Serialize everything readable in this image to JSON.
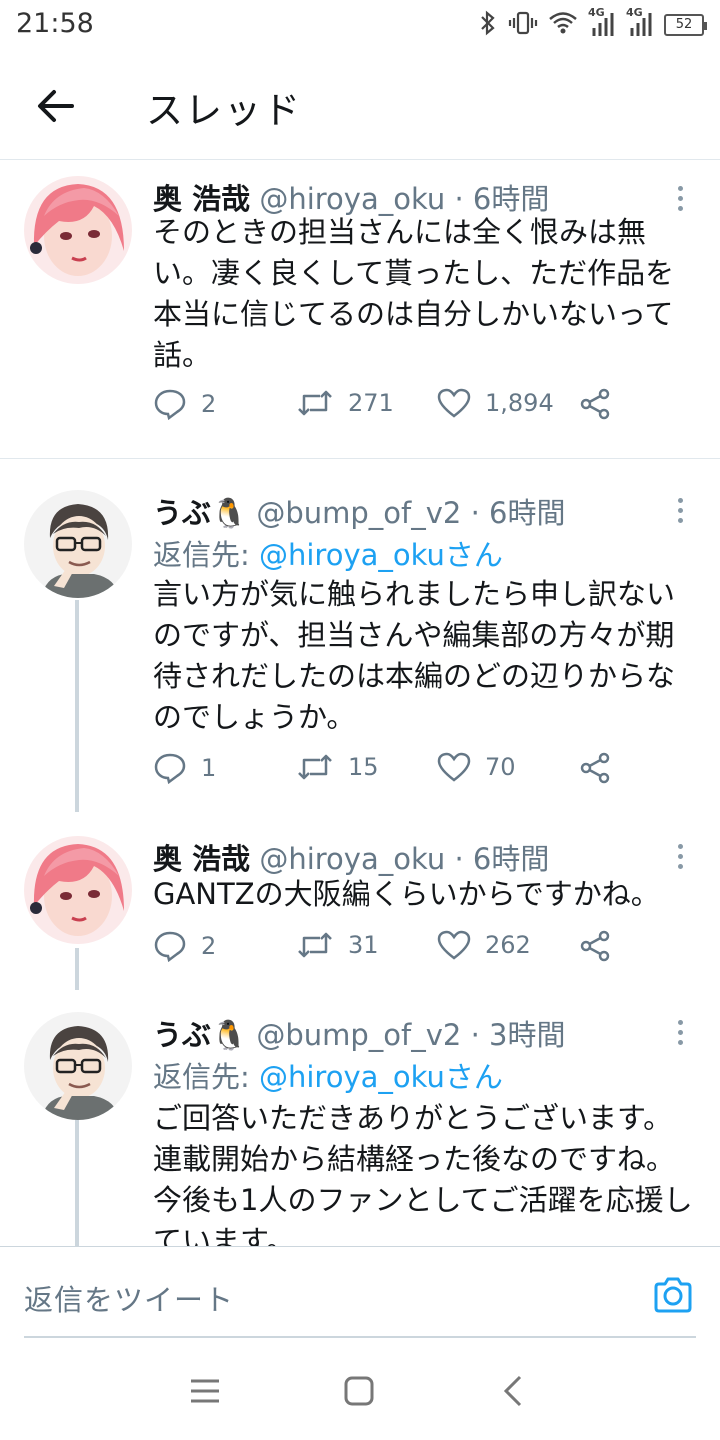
{
  "status_bar": {
    "time": "21:58",
    "network": "4G",
    "network2": "4G",
    "battery": "52"
  },
  "header": {
    "title": "スレッド"
  },
  "tweets": [
    {
      "name": "奥 浩哉",
      "handle": "@hiroya_oku",
      "time": "6時間",
      "reply_to_label": "",
      "reply_to_handle": "",
      "text": "そのときの担当さんには全く恨みは無い。凄く良くして貰ったし、ただ作品を本当に信じてるのは自分しかいないって話。",
      "replies": "2",
      "retweets": "271",
      "likes": "1,894"
    },
    {
      "name": "うぶ🐧",
      "handle": "@bump_of_v2",
      "time": "6時間",
      "reply_to_label": "返信先: ",
      "reply_to_handle": "@hiroya_okuさん",
      "text": "言い方が気に触られましたら申し訳ないのですが、担当さんや編集部の方々が期待されだしたのは本編のどの辺りからなのでしょうか。",
      "replies": "1",
      "retweets": "15",
      "likes": "70"
    },
    {
      "name": "奥 浩哉",
      "handle": "@hiroya_oku",
      "time": "6時間",
      "reply_to_label": "",
      "reply_to_handle": "",
      "text": "GANTZの大阪編くらいからですかね。",
      "replies": "2",
      "retweets": "31",
      "likes": "262"
    },
    {
      "name": "うぶ🐧",
      "handle": "@bump_of_v2",
      "time": "3時間",
      "reply_to_label": "返信先: ",
      "reply_to_handle": "@hiroya_okuさん",
      "text": "ご回答いただきありがとうございます。連載開始から結構経った後なのですね。今後も1人のファンとしてご活躍を応援しています。",
      "replies": "",
      "retweets": "",
      "likes": ""
    }
  ],
  "composer": {
    "placeholder": "返信をツイート"
  },
  "colors": {
    "accent": "#1da1f2",
    "secondary_text": "#657786",
    "divider": "#e1e8ed"
  },
  "icons": {
    "back": "arrow-left-icon",
    "more": "more-vertical-icon",
    "reply": "reply-bubble-icon",
    "retweet": "retweet-icon",
    "like": "heart-icon",
    "share": "share-icon",
    "camera": "camera-icon"
  }
}
